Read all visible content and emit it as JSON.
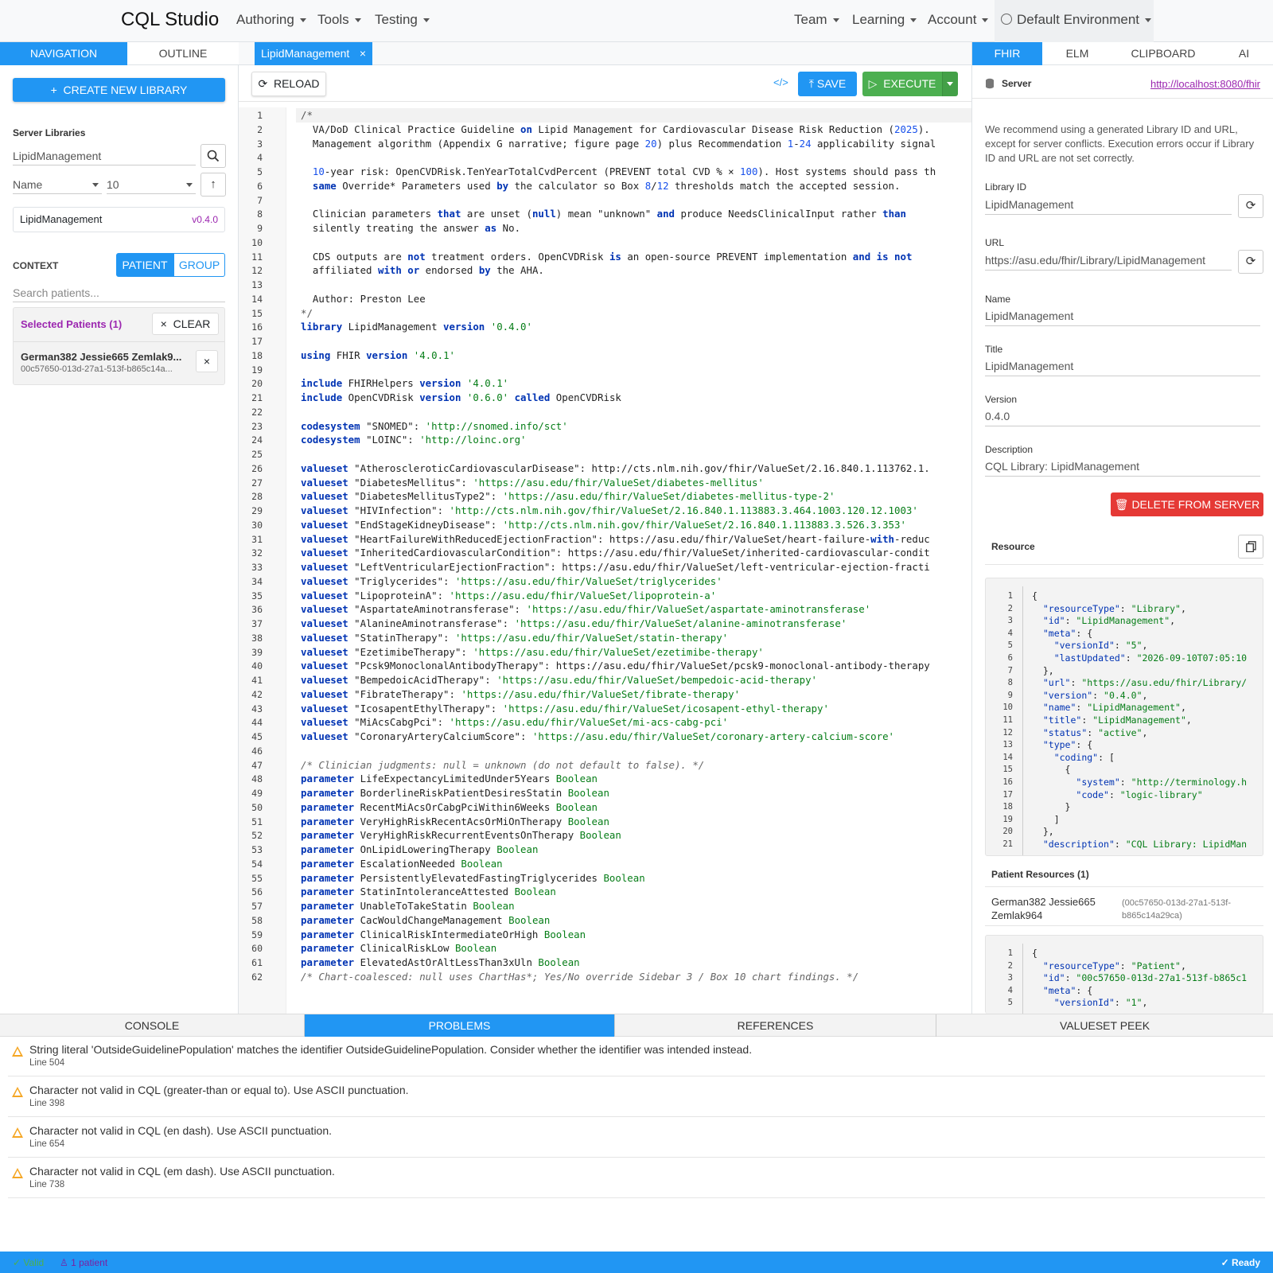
{
  "app": {
    "title": "CQL Studio"
  },
  "nav": {
    "menus": [
      "Authoring",
      "Tools",
      "Testing",
      "Team",
      "Learning",
      "Account",
      "Default Environment"
    ]
  },
  "left": {
    "tabs": [
      "NAVIGATION",
      "OUTLINE"
    ],
    "create_button": "CREATE NEW LIBRARY",
    "server_libraries_label": "Server Libraries",
    "search_value": "LipidManagement",
    "sort_field": "Name",
    "page_size": "10",
    "library_item": {
      "name": "LipidManagement",
      "version": "v0.4.0"
    },
    "context_label": "CONTEXT",
    "context_patient": "PATIENT",
    "context_group": "GROUP",
    "search_patients_placeholder": "Search patients...",
    "selected_patients_label": "Selected Patients (1)",
    "clear_button": "CLEAR",
    "patient": {
      "name": "German382 Jessie665 Zemlak9...",
      "id": "00c57650-013d-27a1-513f-b865c14a..."
    }
  },
  "editor": {
    "tab_label": "LipidManagement",
    "reload": "RELOAD",
    "save": "SAVE",
    "execute": "EXECUTE",
    "lines": [
      "/*",
      "  VA/DoD Clinical Practice Guideline on Lipid Management for Cardiovascular Disease Risk Reduction (2025).",
      "  Management algorithm (Appendix G narrative; figure page 20) plus Recommendation 1-24 applicability signal",
      "",
      "  10-year risk: OpenCVDRisk.TenYearTotalCvdPercent (PREVENT total CVD % × 100). Host systems should pass th",
      "  same Override* Parameters used by the calculator so Box 8/12 thresholds match the accepted session.",
      "",
      "  Clinician parameters that are unset (null) mean \"unknown\" and produce NeedsClinicalInput rather than",
      "  silently treating the answer as No.",
      "",
      "  CDS outputs are not treatment orders. OpenCVDRisk is an open-source PREVENT implementation and is not",
      "  affiliated with or endorsed by the AHA.",
      "",
      "  Author: Preston Lee",
      "*/",
      "library LipidManagement version '0.4.0'",
      "",
      "using FHIR version '4.0.1'",
      "",
      "include FHIRHelpers version '4.0.1'",
      "include OpenCVDRisk version '0.6.0' called OpenCVDRisk",
      "",
      "codesystem \"SNOMED\": 'http://snomed.info/sct'",
      "codesystem \"LOINC\": 'http://loinc.org'",
      "",
      "valueset \"AtheroscleroticCardiovascularDisease\": 'http://cts.nlm.nih.gov/fhir/ValueSet/2.16.840.1.113762.1.",
      "valueset \"DiabetesMellitus\": 'https://asu.edu/fhir/ValueSet/diabetes-mellitus'",
      "valueset \"DiabetesMellitusType2\": 'https://asu.edu/fhir/ValueSet/diabetes-mellitus-type-2'",
      "valueset \"HIVInfection\": 'http://cts.nlm.nih.gov/fhir/ValueSet/2.16.840.1.113883.3.464.1003.120.12.1003'",
      "valueset \"EndStageKidneyDisease\": 'http://cts.nlm.nih.gov/fhir/ValueSet/2.16.840.1.113883.3.526.3.353'",
      "valueset \"HeartFailureWithReducedEjectionFraction\": 'https://asu.edu/fhir/ValueSet/heart-failure-with-reduc",
      "valueset \"InheritedCardiovascularCondition\": 'https://asu.edu/fhir/ValueSet/inherited-cardiovascular-condit",
      "valueset \"LeftVentricularEjectionFraction\": 'https://asu.edu/fhir/ValueSet/left-ventricular-ejection-fracti",
      "valueset \"Triglycerides\": 'https://asu.edu/fhir/ValueSet/triglycerides'",
      "valueset \"LipoproteinA\": 'https://asu.edu/fhir/ValueSet/lipoprotein-a'",
      "valueset \"AspartateAminotransferase\": 'https://asu.edu/fhir/ValueSet/aspartate-aminotransferase'",
      "valueset \"AlanineAminotransferase\": 'https://asu.edu/fhir/ValueSet/alanine-aminotransferase'",
      "valueset \"StatinTherapy\": 'https://asu.edu/fhir/ValueSet/statin-therapy'",
      "valueset \"EzetimibeTherapy\": 'https://asu.edu/fhir/ValueSet/ezetimibe-therapy'",
      "valueset \"Pcsk9MonoclonalAntibodyTherapy\": 'https://asu.edu/fhir/ValueSet/pcsk9-monoclonal-antibody-therapy",
      "valueset \"BempedoicAcidTherapy\": 'https://asu.edu/fhir/ValueSet/bempedoic-acid-therapy'",
      "valueset \"FibrateTherapy\": 'https://asu.edu/fhir/ValueSet/fibrate-therapy'",
      "valueset \"IcosapentEthylTherapy\": 'https://asu.edu/fhir/ValueSet/icosapent-ethyl-therapy'",
      "valueset \"MiAcsCabgPci\": 'https://asu.edu/fhir/ValueSet/mi-acs-cabg-pci'",
      "valueset \"CoronaryArteryCalciumScore\": 'https://asu.edu/fhir/ValueSet/coronary-artery-calcium-score'",
      "",
      "/* Clinician judgments: null = unknown (do not default to false). */",
      "parameter LifeExpectancyLimitedUnder5Years Boolean",
      "parameter BorderlineRiskPatientDesiresStatin Boolean",
      "parameter RecentMiAcsOrCabgPciWithin6Weeks Boolean",
      "parameter VeryHighRiskRecentAcsOrMiOnTherapy Boolean",
      "parameter VeryHighRiskRecurrentEventsOnTherapy Boolean",
      "parameter OnLipidLoweringTherapy Boolean",
      "parameter EscalationNeeded Boolean",
      "parameter PersistentlyElevatedFastingTriglycerides Boolean",
      "parameter StatinIntoleranceAttested Boolean",
      "parameter UnableToTakeStatin Boolean",
      "parameter CacWouldChangeManagement Boolean",
      "parameter ClinicalRiskIntermediateOrHigh Boolean",
      "parameter ClinicalRiskLow Boolean",
      "parameter ElevatedAstOrAltLessThan3xUln Boolean",
      "/* Chart-coalesced: null uses ChartHas*; Yes/No override Sidebar 3 / Box 10 chart findings. */"
    ]
  },
  "right": {
    "tabs": [
      "FHIR",
      "ELM",
      "CLIPBOARD",
      "AI"
    ],
    "server_label": "Server",
    "server_url": "http://localhost:8080/fhir",
    "recommendation": "We recommend using a generated Library ID and URL, except for server conflicts. Execution errors occur if Library ID and URL are not set correctly.",
    "library_id_label": "Library ID",
    "library_id": "LipidManagement",
    "url_label": "URL",
    "url": "https://asu.edu/fhir/Library/LipidManagement",
    "name_label": "Name",
    "name": "LipidManagement",
    "title_label": "Title",
    "title": "LipidManagement",
    "version_label": "Version",
    "version": "0.4.0",
    "description_label": "Description",
    "description": "CQL Library: LipidManagement",
    "delete_button": "DELETE FROM SERVER",
    "resource_label": "Resource",
    "resource_json": [
      "{",
      "  \"resourceType\": \"Library\",",
      "  \"id\": \"LipidManagement\",",
      "  \"meta\": {",
      "    \"versionId\": \"5\",",
      "    \"lastUpdated\": \"2026-09-10T07:05:10",
      "  },",
      "  \"url\": \"https://asu.edu/fhir/Library/",
      "  \"version\": \"0.4.0\",",
      "  \"name\": \"LipidManagement\",",
      "  \"title\": \"LipidManagement\",",
      "  \"status\": \"active\",",
      "  \"type\": {",
      "    \"coding\": [",
      "      {",
      "        \"system\": \"http://terminology.h",
      "        \"code\": \"logic-library\"",
      "      }",
      "    ]",
      "  },",
      "  \"description\": \"CQL Library: LipidMan"
    ],
    "patient_resources_label": "Patient Resources (1)",
    "patient_name": "German382 Jessie665 Zemlak964",
    "patient_id": "(00c57650-013d-27a1-513f-b865c14a29ca)",
    "patient_json": [
      "{",
      "  \"resourceType\": \"Patient\",",
      "  \"id\": \"00c57650-013d-27a1-513f-b865c1",
      "  \"meta\": {",
      "    \"versionId\": \"1\","
    ]
  },
  "bottom": {
    "tabs": [
      "CONSOLE",
      "PROBLEMS",
      "REFERENCES",
      "VALUESET PEEK"
    ],
    "problems": [
      {
        "message": "String literal 'OutsideGuidelinePopulation' matches the identifier OutsideGuidelinePopulation. Consider whether the identifier was intended instead.",
        "line": "Line 504"
      },
      {
        "message": "Character not valid in CQL (greater-than or equal to). Use ASCII punctuation.",
        "line": "Line 398"
      },
      {
        "message": "Character not valid in CQL (en dash). Use ASCII punctuation.",
        "line": "Line 654"
      },
      {
        "message": "Character not valid in CQL (em dash). Use ASCII punctuation.",
        "line": "Line 738"
      }
    ]
  },
  "status": {
    "valid": "Valid",
    "patients": "1 patient",
    "ready": "Ready"
  },
  "colors": {
    "accent": "#2196f3",
    "success": "#4caf50",
    "danger": "#e53935",
    "warning": "#f5a623",
    "purple": "#9c27b0"
  }
}
